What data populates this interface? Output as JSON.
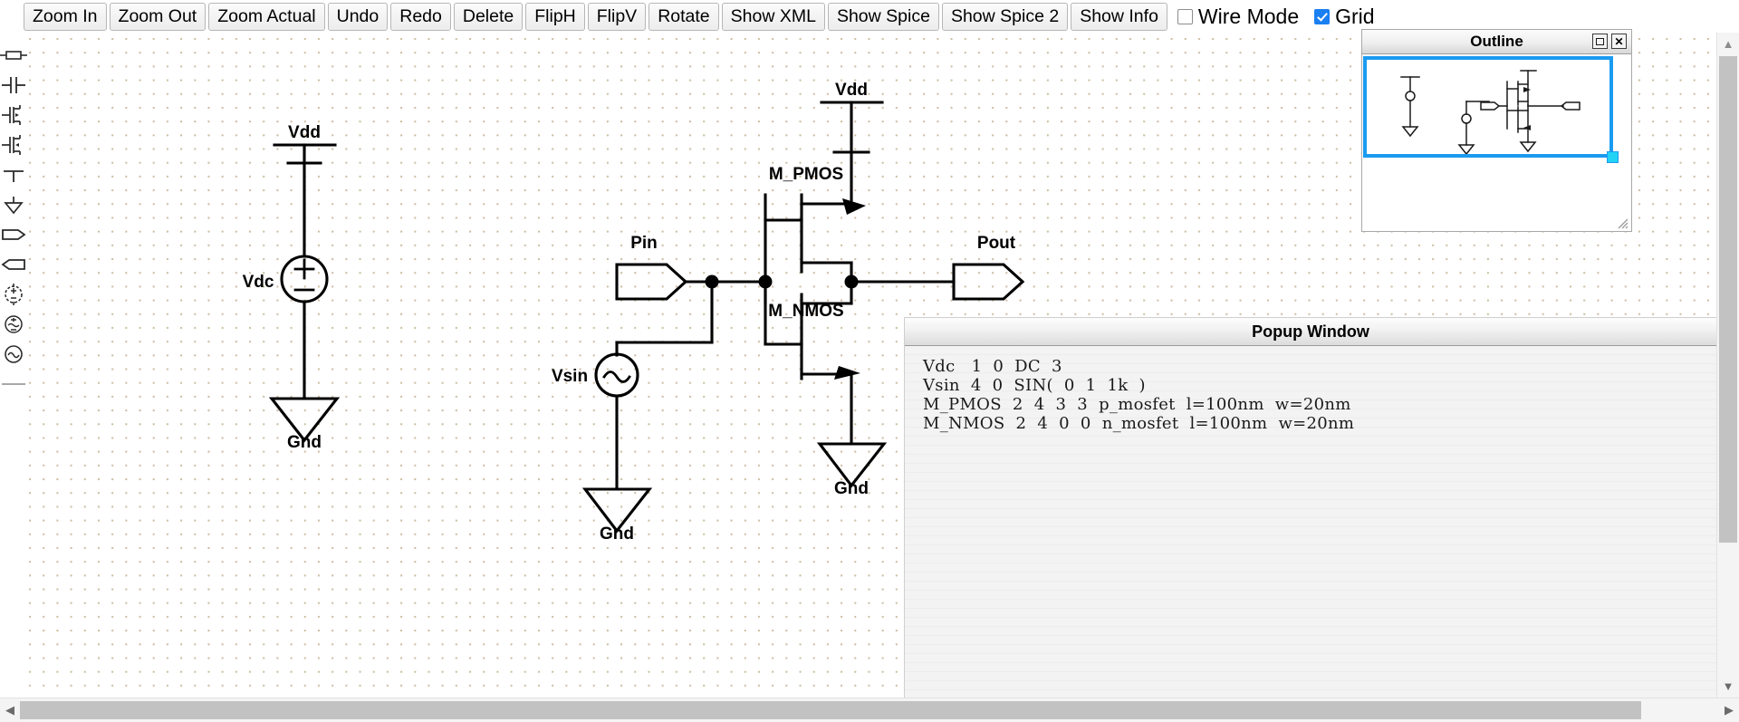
{
  "toolbar": {
    "buttons": [
      {
        "label": "Zoom In",
        "name": "zoom-in-button"
      },
      {
        "label": "Zoom Out",
        "name": "zoom-out-button"
      },
      {
        "label": "Zoom Actual",
        "name": "zoom-actual-button"
      },
      {
        "label": "Undo",
        "name": "undo-button"
      },
      {
        "label": "Redo",
        "name": "redo-button"
      },
      {
        "label": "Delete",
        "name": "delete-button"
      },
      {
        "label": "FlipH",
        "name": "flip-horizontal-button"
      },
      {
        "label": "FlipV",
        "name": "flip-vertical-button"
      },
      {
        "label": "Rotate",
        "name": "rotate-button"
      },
      {
        "label": "Show XML",
        "name": "show-xml-button"
      },
      {
        "label": "Show Spice",
        "name": "show-spice-button"
      },
      {
        "label": "Show Spice 2",
        "name": "show-spice-2-button"
      },
      {
        "label": "Show Info",
        "name": "show-info-button"
      }
    ],
    "checkboxes": [
      {
        "label": "Wire Mode",
        "checked": false,
        "name": "wire-mode-checkbox"
      },
      {
        "label": "Grid",
        "checked": true,
        "name": "grid-checkbox"
      }
    ]
  },
  "palette": {
    "items": [
      {
        "icon": "resistor-icon",
        "title": "Resistor"
      },
      {
        "icon": "capacitor-icon",
        "title": "Capacitor"
      },
      {
        "icon": "nmos-icon",
        "title": "NMOS transistor"
      },
      {
        "icon": "pmos-icon",
        "title": "PMOS transistor"
      },
      {
        "icon": "vdd-rail-icon",
        "title": "Vdd rail"
      },
      {
        "icon": "ground-icon",
        "title": "Ground"
      },
      {
        "icon": "pin-input-icon",
        "title": "Input pin"
      },
      {
        "icon": "pin-output-icon",
        "title": "Output pin"
      },
      {
        "icon": "dc-source-icon",
        "title": "DC source"
      },
      {
        "icon": "ac-source-icon",
        "title": "AC source"
      },
      {
        "icon": "sine-source-icon",
        "title": "Sine source"
      },
      {
        "icon": "wire-icon",
        "title": "Wire"
      }
    ]
  },
  "schematic": {
    "labels": {
      "vdd_left": "Vdd",
      "vdc": "Vdc",
      "gnd_left": "Gnd",
      "pin_in": "Pin",
      "vsin": "Vsin",
      "gnd_mid": "Gnd",
      "vdd_right": "Vdd",
      "m_pmos": "M_PMOS",
      "m_nmos": "M_NMOS",
      "pin_out": "Pout",
      "gnd_right": "Gnd"
    }
  },
  "popup": {
    "title": "Popup Window",
    "netlist": [
      "Vdc   1  0  DC  3",
      "Vsin  4  0  SIN(  0  1  1k  )",
      "M_PMOS  2  4  3  3  p_mosfet  l=100nm  w=20nm",
      "M_NMOS  2  4  0  0  n_mosfet  l=100nm  w=20nm"
    ]
  },
  "outline": {
    "title": "Outline",
    "maximize_label": "",
    "close_label": "✕"
  },
  "colors": {
    "accent": "#1b9bf0",
    "handle": "#22d3f5",
    "checkbox_checked": "#1a7ff0",
    "grid_dot": "#cdbfa2",
    "wire": "#000000",
    "scrollbar_thumb": "#c2c2c2"
  }
}
